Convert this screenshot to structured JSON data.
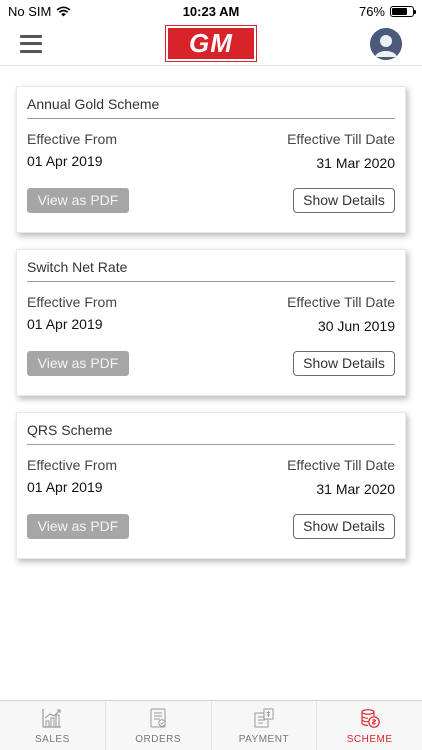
{
  "status_bar": {
    "carrier": "No SIM",
    "time": "10:23 AM",
    "battery_percent": "76%",
    "battery_level": 0.76
  },
  "header": {
    "logo_text": "GM",
    "menu_icon": "hamburger-icon",
    "profile_icon": "user-avatar-icon"
  },
  "colors": {
    "accent": "#d8232a",
    "button_gray": "#a6a6a6"
  },
  "schemes": [
    {
      "title": "Annual Gold Scheme",
      "from_label": "Effective From",
      "from_value": "01 Apr 2019",
      "till_label": "Effective Till Date",
      "till_value": "31 Mar 2020",
      "pdf_label": "View as PDF",
      "details_label": "Show Details"
    },
    {
      "title": "Switch Net Rate",
      "from_label": "Effective From",
      "from_value": "01 Apr 2019",
      "till_label": "Effective Till Date",
      "till_value": "30 Jun 2019",
      "pdf_label": "View as PDF",
      "details_label": "Show Details"
    },
    {
      "title": "QRS Scheme",
      "from_label": "Effective From",
      "from_value": "01 Apr 2019",
      "till_label": "Effective Till Date",
      "till_value": "31 Mar 2020",
      "pdf_label": "View as PDF",
      "details_label": "Show Details"
    }
  ],
  "tabs": [
    {
      "label": "SALES",
      "icon": "sales-chart-icon",
      "active": false
    },
    {
      "label": "ORDERS",
      "icon": "orders-list-icon",
      "active": false
    },
    {
      "label": "PAYMENT",
      "icon": "payment-icon",
      "active": false
    },
    {
      "label": "SCHEME",
      "icon": "scheme-coins-icon",
      "active": true
    }
  ]
}
